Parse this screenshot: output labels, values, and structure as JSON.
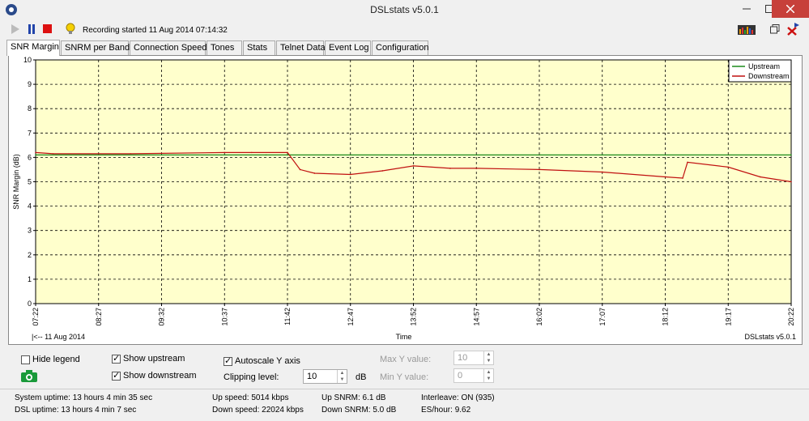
{
  "window": {
    "title": "DSLstats v5.0.1"
  },
  "toolbar": {
    "recording_status": "Recording started 11 Aug 2014 07:14:32"
  },
  "tabs": [
    "SNR Margin",
    "SNRM per Band",
    "Connection Speed",
    "Tones",
    "Stats",
    "Telnet Data",
    "Event Log",
    "Configuration"
  ],
  "chart_data": {
    "type": "line",
    "ylabel": "SNR Margin (dB)",
    "xlabel": "Time",
    "ylim": [
      0,
      10
    ],
    "y_ticks": [
      "0",
      "1",
      "2",
      "3",
      "4",
      "5",
      "6",
      "7",
      "8",
      "9",
      "10"
    ],
    "x_ticks": [
      "07:22",
      "08:27",
      "09:32",
      "10:37",
      "11:42",
      "12:47",
      "13:52",
      "14:57",
      "16:02",
      "17:07",
      "18:12",
      "19:17",
      "20:22"
    ],
    "date_label": "|<-- 11 Aug 2014",
    "watermark": "DSLstats v5.0.1",
    "grid": true,
    "legend_position": "top-right",
    "series": [
      {
        "name": "Upstream",
        "color": "#1a8a1a",
        "x": [
          "07:22",
          "11:20",
          "11:42",
          "20:22"
        ],
        "values": [
          6.1,
          6.1,
          6.1,
          6.1
        ]
      },
      {
        "name": "Downstream",
        "color": "#c01010",
        "x": [
          "07:22",
          "07:40",
          "09:00",
          "10:37",
          "11:05",
          "11:42",
          "11:55",
          "12:10",
          "12:47",
          "13:20",
          "13:52",
          "14:30",
          "14:57",
          "16:02",
          "17:07",
          "18:12",
          "18:30",
          "18:35",
          "19:17",
          "19:50",
          "20:22"
        ],
        "values": [
          6.2,
          6.15,
          6.15,
          6.2,
          6.2,
          6.2,
          5.5,
          5.35,
          5.3,
          5.45,
          5.65,
          5.55,
          5.55,
          5.5,
          5.4,
          5.2,
          5.15,
          5.8,
          5.6,
          5.2,
          5.0
        ]
      }
    ]
  },
  "controls": {
    "hide_legend": "Hide legend",
    "show_upstream": "Show upstream",
    "show_downstream": "Show downstream",
    "autoscale_y": "Autoscale Y axis",
    "clipping_level": "Clipping level:",
    "clipping_value": "10",
    "clipping_unit": "dB",
    "max_y_label": "Max Y value:",
    "max_y_value": "10",
    "min_y_label": "Min Y value:",
    "min_y_value": "0"
  },
  "status": {
    "system_uptime": "System uptime:  13 hours 4 min 35 sec",
    "dsl_uptime": "DSL uptime: 13 hours 4 min 7 sec",
    "up_speed": "Up speed: 5014 kbps",
    "down_speed": "Down speed: 22024 kbps",
    "up_snrm": "Up SNRM: 6.1 dB",
    "down_snrm": "Down SNRM: 5.0 dB",
    "interleave": "Interleave: ON (935)",
    "es_hour": "ES/hour: 9.62"
  }
}
